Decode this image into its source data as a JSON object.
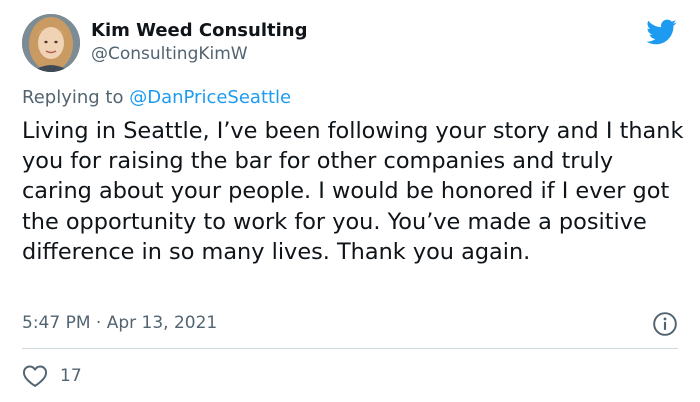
{
  "author": {
    "display_name": "Kim Weed Consulting",
    "handle": "@ConsultingKimW",
    "avatar_icon": "profile-photo"
  },
  "reply": {
    "prefix": "Replying to ",
    "mention": "@DanPriceSeattle"
  },
  "tweet": {
    "text": "Living in Seattle, I’ve been following your story and I thank you for raising the bar for other companies and truly caring about your people. I would be honored if I ever got the opportunity to work for you. You’ve made a positive difference in so many lives. Thank you again.",
    "timestamp": "5:47 PM · Apr 13, 2021"
  },
  "actions": {
    "like_count": "17",
    "like_icon": "heart-icon",
    "info_icon": "info-icon",
    "brand_icon": "twitter-bird-icon"
  },
  "colors": {
    "brand": "#1d9bf0",
    "secondary_text": "#536471",
    "primary_text": "#0f1419",
    "divider": "#cfd9de"
  }
}
